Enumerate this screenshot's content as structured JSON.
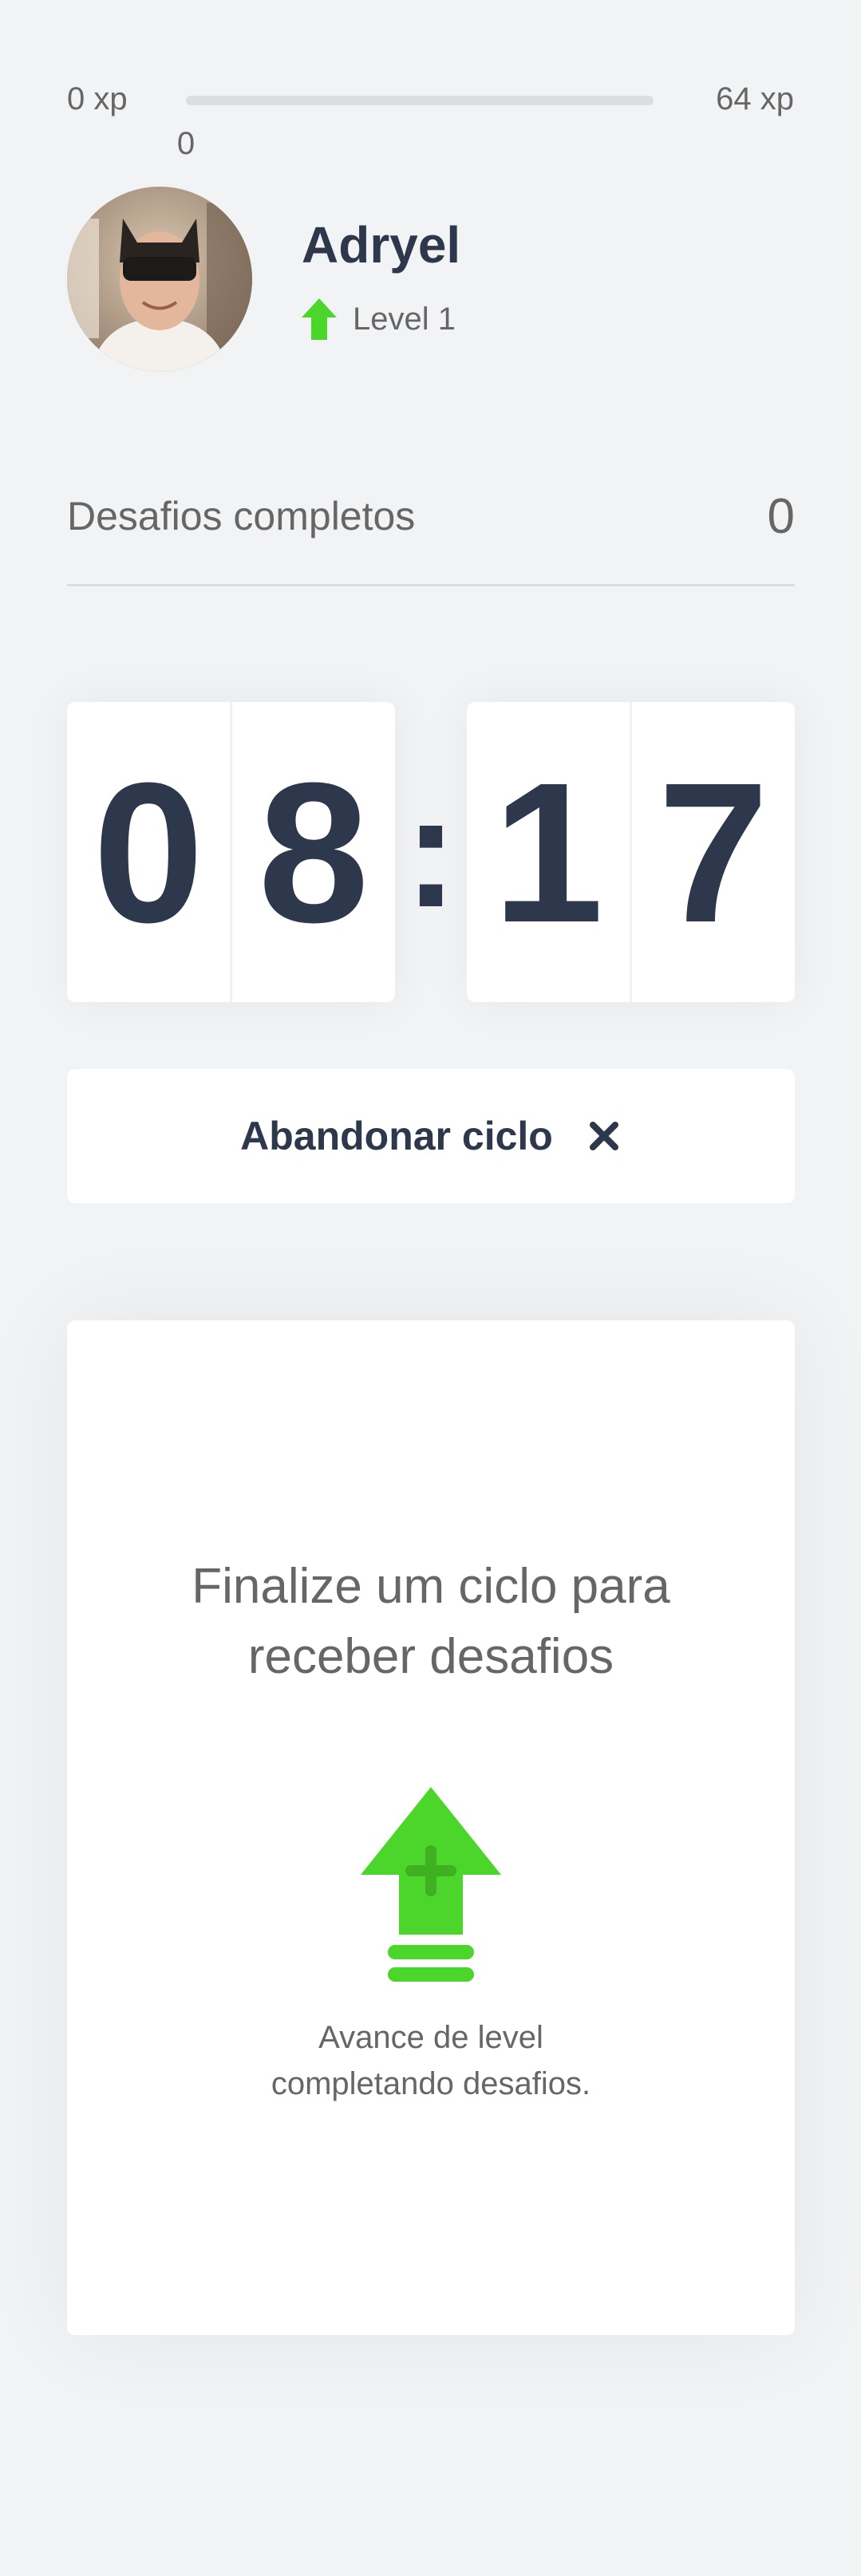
{
  "xp": {
    "start_label": "0 xp",
    "end_label": "64 xp",
    "current_label": "0",
    "progress": 0.0,
    "accent": "#4CD62B"
  },
  "profile": {
    "name": "Adryel",
    "level_label": "Level 1",
    "level_icon": "level-up-arrow-icon"
  },
  "challenges": {
    "label": "Desafios completos",
    "count": "0"
  },
  "countdown": {
    "minutes_tens": "0",
    "minutes_ones": "8",
    "separator": ":",
    "seconds_tens": "1",
    "seconds_ones": "7"
  },
  "abandon_button": {
    "label": "Abandonar ciclo",
    "icon": "close-icon"
  },
  "challenge_box": {
    "title_line1": "Finalize um ciclo para",
    "title_line2": "receber desafios",
    "hint_line1": "Avance de level",
    "hint_line2": "completando desafios.",
    "icon": "level-up-icon"
  },
  "colors": {
    "background": "#F2F3F5",
    "card": "#FFFFFF",
    "title": "#2E384D",
    "text": "#666666",
    "green": "#4CD62B"
  }
}
